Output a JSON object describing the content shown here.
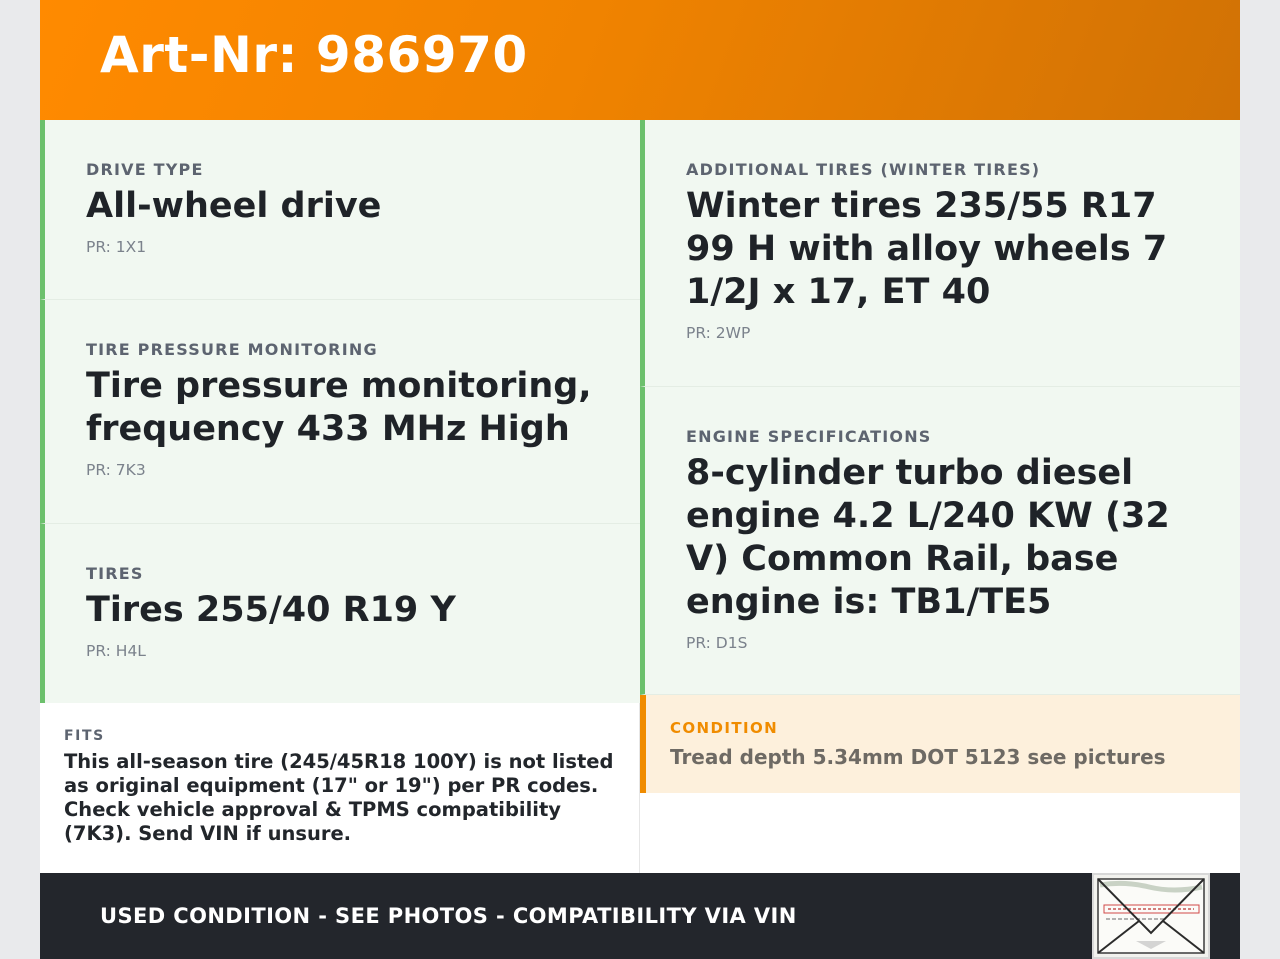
{
  "header": {
    "title": "Art-Nr: 986970"
  },
  "left_cards": [
    {
      "label": "DRIVE TYPE",
      "value": "All-wheel drive",
      "pr": "PR: 1X1"
    },
    {
      "label": "TIRE PRESSURE MONITORING",
      "value": "Tire pressure monitoring, frequency 433 MHz High",
      "pr": "PR: 7K3"
    },
    {
      "label": "TIRES",
      "value": "Tires 255/40 R19 Y",
      "pr": "PR: H4L"
    }
  ],
  "right_cards": [
    {
      "label": "ADDITIONAL TIRES (WINTER TIRES)",
      "value": "Winter tires 235/55 R17 99 H with alloy wheels 7 1/2J x 17, ET 40",
      "pr": "PR: 2WP"
    },
    {
      "label": "ENGINE SPECIFICATIONS",
      "value": "8-cylinder turbo diesel engine 4.2 L/240 KW (32 V) Common Rail, base engine is: TB1/TE5",
      "pr": "PR: D1S"
    }
  ],
  "fits": {
    "label": "FITS",
    "text": "This all-season tire (245/45R18 100Y) is not listed as original equipment (17\" or 19\") per PR codes. Check vehicle approval & TPMS compatibility (7K3). Send VIN if unsure."
  },
  "condition": {
    "label": "CONDITION",
    "text": "Tread depth 5.34mm DOT 5123 see pictures"
  },
  "footer": {
    "text": "USED CONDITION - SEE PHOTOS - COMPATIBILITY VIA VIN",
    "image_label": "vehicle data sticker photo"
  },
  "colors": {
    "header_accent": "#ff8a00",
    "card_border": "#6cc06c",
    "card_background": "#f1f8f1",
    "condition_accent": "#f08c00",
    "condition_background": "#fdf0dc",
    "footer_background": "#23262c"
  }
}
